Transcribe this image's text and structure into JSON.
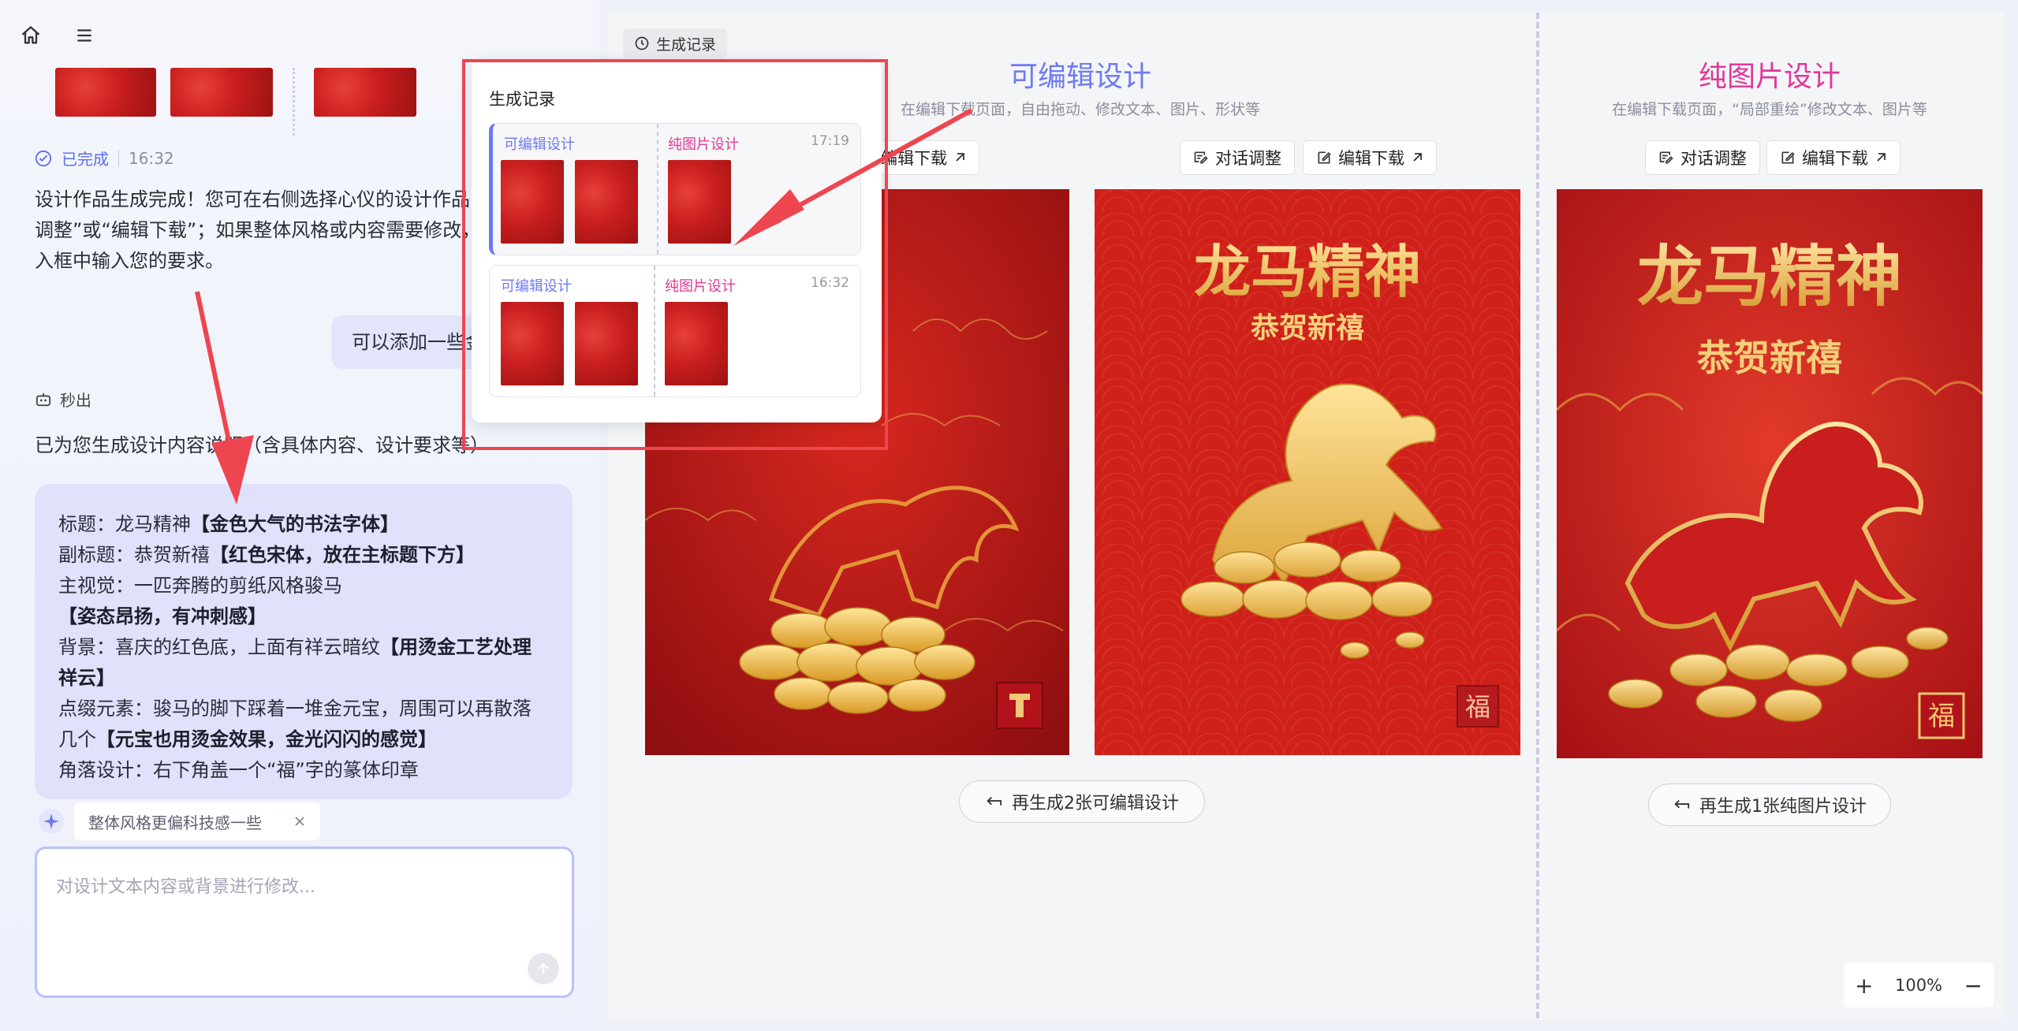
{
  "left": {
    "status": {
      "label": "已完成",
      "time": "16:32"
    },
    "message": [
      "设计作品生成完成！您可在右侧选择心仪的设计作品",
      "调整”或“编辑下载”；如果整体风格或内容需要修改，",
      "入框中输入您的要求。"
    ],
    "user_message": "可以添加一些金",
    "ai_status": "秒出",
    "ai_intro": "已为您生成设计内容说明（含具体内容、设计要求等）",
    "spec": [
      {
        "label": "标题：龙马精神",
        "bold": "【金色大气的书法字体】"
      },
      {
        "label": "副标题：恭贺新禧",
        "bold": "【红色宋体，放在主标题下方】"
      },
      {
        "label": "主视觉：一匹奔腾的剪纸风格骏马",
        "bold": "【姿态昂扬，有冲刺感】"
      },
      {
        "label": "背景：喜庆的红色底，上面有祥云暗纹",
        "bold": "【用烫金工艺处理祥云】"
      },
      {
        "label": "点缀元素：骏马的脚下踩着一堆金元宝，周围可以再散落几个",
        "bold": "【元宝也用烫金效果，金光闪闪的感觉】"
      },
      {
        "label": "角落设计：右下角盖一个“福”字的篆体印章",
        "bold": ""
      }
    ],
    "suggestion": "整体风格更偏科技感一些",
    "input_placeholder": "对设计文本内容或背景进行修改..."
  },
  "main": {
    "history_button": "生成记录",
    "editable": {
      "title": "可编辑设计",
      "subtitle": "在编辑下载页面，自由拖动、修改文本、图片、形状等",
      "regen": "再生成2张可编辑设计"
    },
    "pure": {
      "title": "纯图片设计",
      "subtitle": "在编辑下载页面，“局部重绘”修改文本、图片等",
      "regen": "再生成1张纯图片设计"
    },
    "actions": {
      "chat": "对话调整",
      "download": "编辑下载"
    },
    "poster": {
      "title": "龙马精神",
      "subtitle": "恭贺新禧",
      "seal": "福"
    },
    "zoom": {
      "level": "100%",
      "plus": "+",
      "minus": "−"
    }
  },
  "popup": {
    "title": "生成记录",
    "records": [
      {
        "left_label": "可编辑设计",
        "right_label": "纯图片设计",
        "time": "17:19"
      },
      {
        "left_label": "可编辑设计",
        "right_label": "纯图片设计",
        "time": "16:32"
      }
    ]
  },
  "colors": {
    "accent": "#6e7af3",
    "pink": "#e0389a",
    "poster_red": "#c81e1e",
    "gold": "#f3c75a",
    "annotation_red": "#ee4650"
  }
}
